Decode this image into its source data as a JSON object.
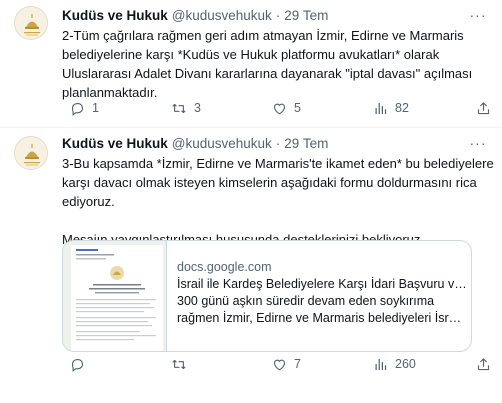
{
  "tweets": [
    {
      "display_name": "Kudüs ve Hukuk",
      "handle": "@kudusvehukuk",
      "separator": "·",
      "date": "29 Tem",
      "more_label": "···",
      "lines": [
        "2-Tüm çağrılara rağmen geri adım atmayan İzmir, Edirne ve Marmaris",
        "belediyelerine karşı *Kudüs ve Hukuk platformu avukatları* olarak",
        "Uluslararası Adalet Divanı kararlarına dayanarak \"iptal davası\" açılması",
        "planlanmaktadır."
      ],
      "actions": {
        "replies": "1",
        "retweets": "3",
        "likes": "5",
        "views": "82"
      }
    },
    {
      "display_name": "Kudüs ve Hukuk",
      "handle": "@kudusvehukuk",
      "separator": "·",
      "date": "29 Tem",
      "more_label": "···",
      "lines": [
        "3-Bu kapsamda *İzmir, Edirne ve Marmaris'te ikamet eden* bu belediyelere",
        "karşı davacı olmak isteyen kimselerin aşağıdaki formu doldurmasını rica",
        "ediyoruz."
      ],
      "lines2": [
        "Mesajın yaygınlaştırılması hususunda desteklerinizi bekliyoruz."
      ],
      "card": {
        "domain": "docs.google.com",
        "title": "İsrail ile Kardeş Belediyelere Karşı İdari Başvuru ve İp…",
        "desc_line1": "300 günü aşkın süredir devam eden soykırıma",
        "desc_line2": "rağmen İzmir, Edirne ve Marmaris belediyeleri İsrail …"
      },
      "actions": {
        "replies": "",
        "retweets": "",
        "likes": "7",
        "views": "260"
      }
    }
  ],
  "icons": {
    "reply": "reply-icon",
    "retweet": "retweet-icon",
    "like": "heart-icon",
    "views": "views-icon",
    "share": "share-icon",
    "more": "more-icon"
  },
  "colors": {
    "text": "#0f1419",
    "secondary": "#536471",
    "border": "#cfd9de",
    "divider": "#eff3f4"
  }
}
